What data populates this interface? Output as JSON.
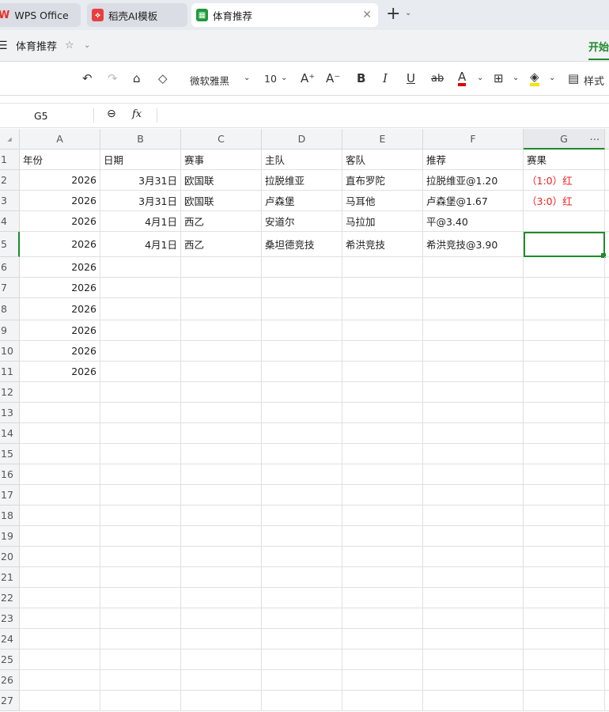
{
  "tabs": [
    {
      "label": "WPS Office",
      "icon": "wps-logo-icon"
    },
    {
      "label": "稻壳AI模板",
      "icon": "docer-icon"
    },
    {
      "label": "体育推荐",
      "icon": "spreadsheet-icon",
      "active": true
    }
  ],
  "menubar": {
    "doc_title": "体育推荐",
    "ribbon_tab": "开始"
  },
  "toolbar": {
    "font": "微软雅黑",
    "size": "10",
    "style_label": "样式",
    "font_color": "#e00000",
    "fill_color": "#f5e400"
  },
  "formula_bar": {
    "cell_ref": "G5",
    "formula": ""
  },
  "columns": [
    "A",
    "B",
    "C",
    "D",
    "E",
    "F",
    "G"
  ],
  "rows": [
    [
      "年份",
      "日期",
      "赛事",
      "主队",
      "客队",
      "推荐",
      "赛果"
    ],
    [
      "2026",
      "3月31日",
      "欧国联",
      "拉脱维亚",
      "直布罗陀",
      "拉脱维亚@1.20",
      "（1:0）红"
    ],
    [
      "2026",
      "3月31日",
      "欧国联",
      "卢森堡",
      "马耳他",
      "卢森堡@1.67",
      "（3:0）红"
    ],
    [
      "2026",
      "4月1日",
      "西乙",
      "安道尔",
      "马拉加",
      "平@3.40",
      ""
    ],
    [
      "2026",
      "4月1日",
      "西乙",
      "桑坦德竞技",
      "希洪竞技",
      "希洪竞技@3.90",
      ""
    ],
    [
      "2026",
      "",
      "",
      "",
      "",
      "",
      ""
    ],
    [
      "2026",
      "",
      "",
      "",
      "",
      "",
      ""
    ],
    [
      "2026",
      "",
      "",
      "",
      "",
      "",
      ""
    ],
    [
      "2026",
      "",
      "",
      "",
      "",
      "",
      ""
    ],
    [
      "2026",
      "",
      "",
      "",
      "",
      "",
      ""
    ],
    [
      "2026",
      "",
      "",
      "",
      "",
      "",
      ""
    ]
  ],
  "row_count": 27,
  "selected_cell": "G5",
  "accent": "#1f8a2e"
}
